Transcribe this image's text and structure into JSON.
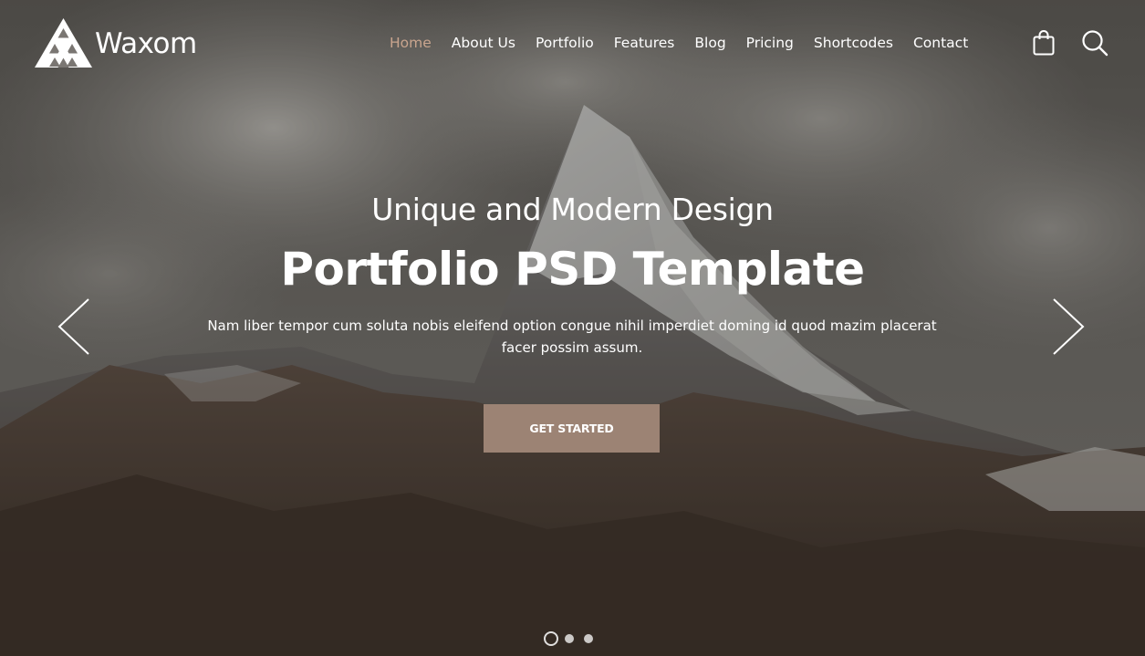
{
  "brand": {
    "name": "Waxom",
    "logo_icon": "triangle-logo-icon"
  },
  "nav": {
    "items": [
      {
        "label": "Home",
        "active": true
      },
      {
        "label": "About Us",
        "active": false
      },
      {
        "label": "Portfolio",
        "active": false
      },
      {
        "label": "Features",
        "active": false
      },
      {
        "label": "Blog",
        "active": false
      },
      {
        "label": "Pricing",
        "active": false
      },
      {
        "label": "Shortcodes",
        "active": false
      },
      {
        "label": "Contact",
        "active": false
      }
    ],
    "cart_icon": "shopping-bag-icon",
    "search_icon": "search-icon"
  },
  "hero": {
    "subtitle": "Unique and Modern Design",
    "title": "Portfolio PSD Template",
    "description": "Nam liber tempor cum soluta nobis eleifend option congue nihil imperdiet doming id quod mazim placerat facer possim assum.",
    "cta_label": "GET STARTED",
    "prev_icon": "chevron-left-icon",
    "next_icon": "chevron-right-icon",
    "slides_total": 3,
    "active_slide": 1
  },
  "colors": {
    "accent": "#c9a58e",
    "button": "#9c8374",
    "text": "#ffffff"
  }
}
